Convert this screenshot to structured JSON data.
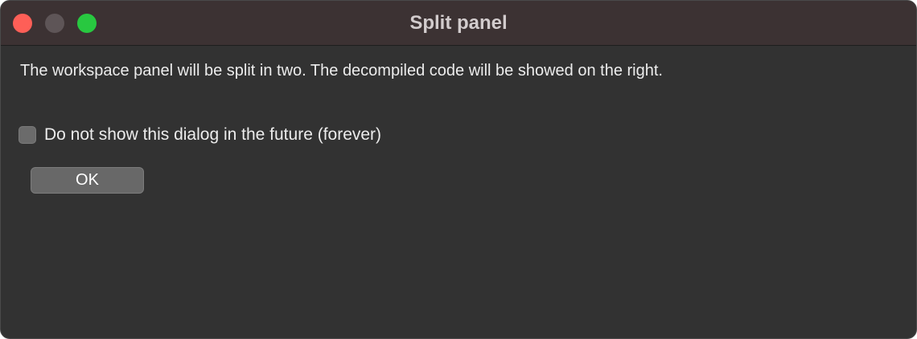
{
  "window": {
    "title": "Split panel"
  },
  "dialog": {
    "message": "The workspace panel will be split in two. The decompiled code will be showed on the right.",
    "checkbox": {
      "label": "Do not show this dialog in the future (forever)",
      "checked": false
    },
    "ok_label": "OK"
  },
  "colors": {
    "close": "#fe5f57",
    "minimize": "#5e5557",
    "zoom": "#28c840",
    "window_background": "#323232",
    "titlebar_background": "#3c3233"
  }
}
